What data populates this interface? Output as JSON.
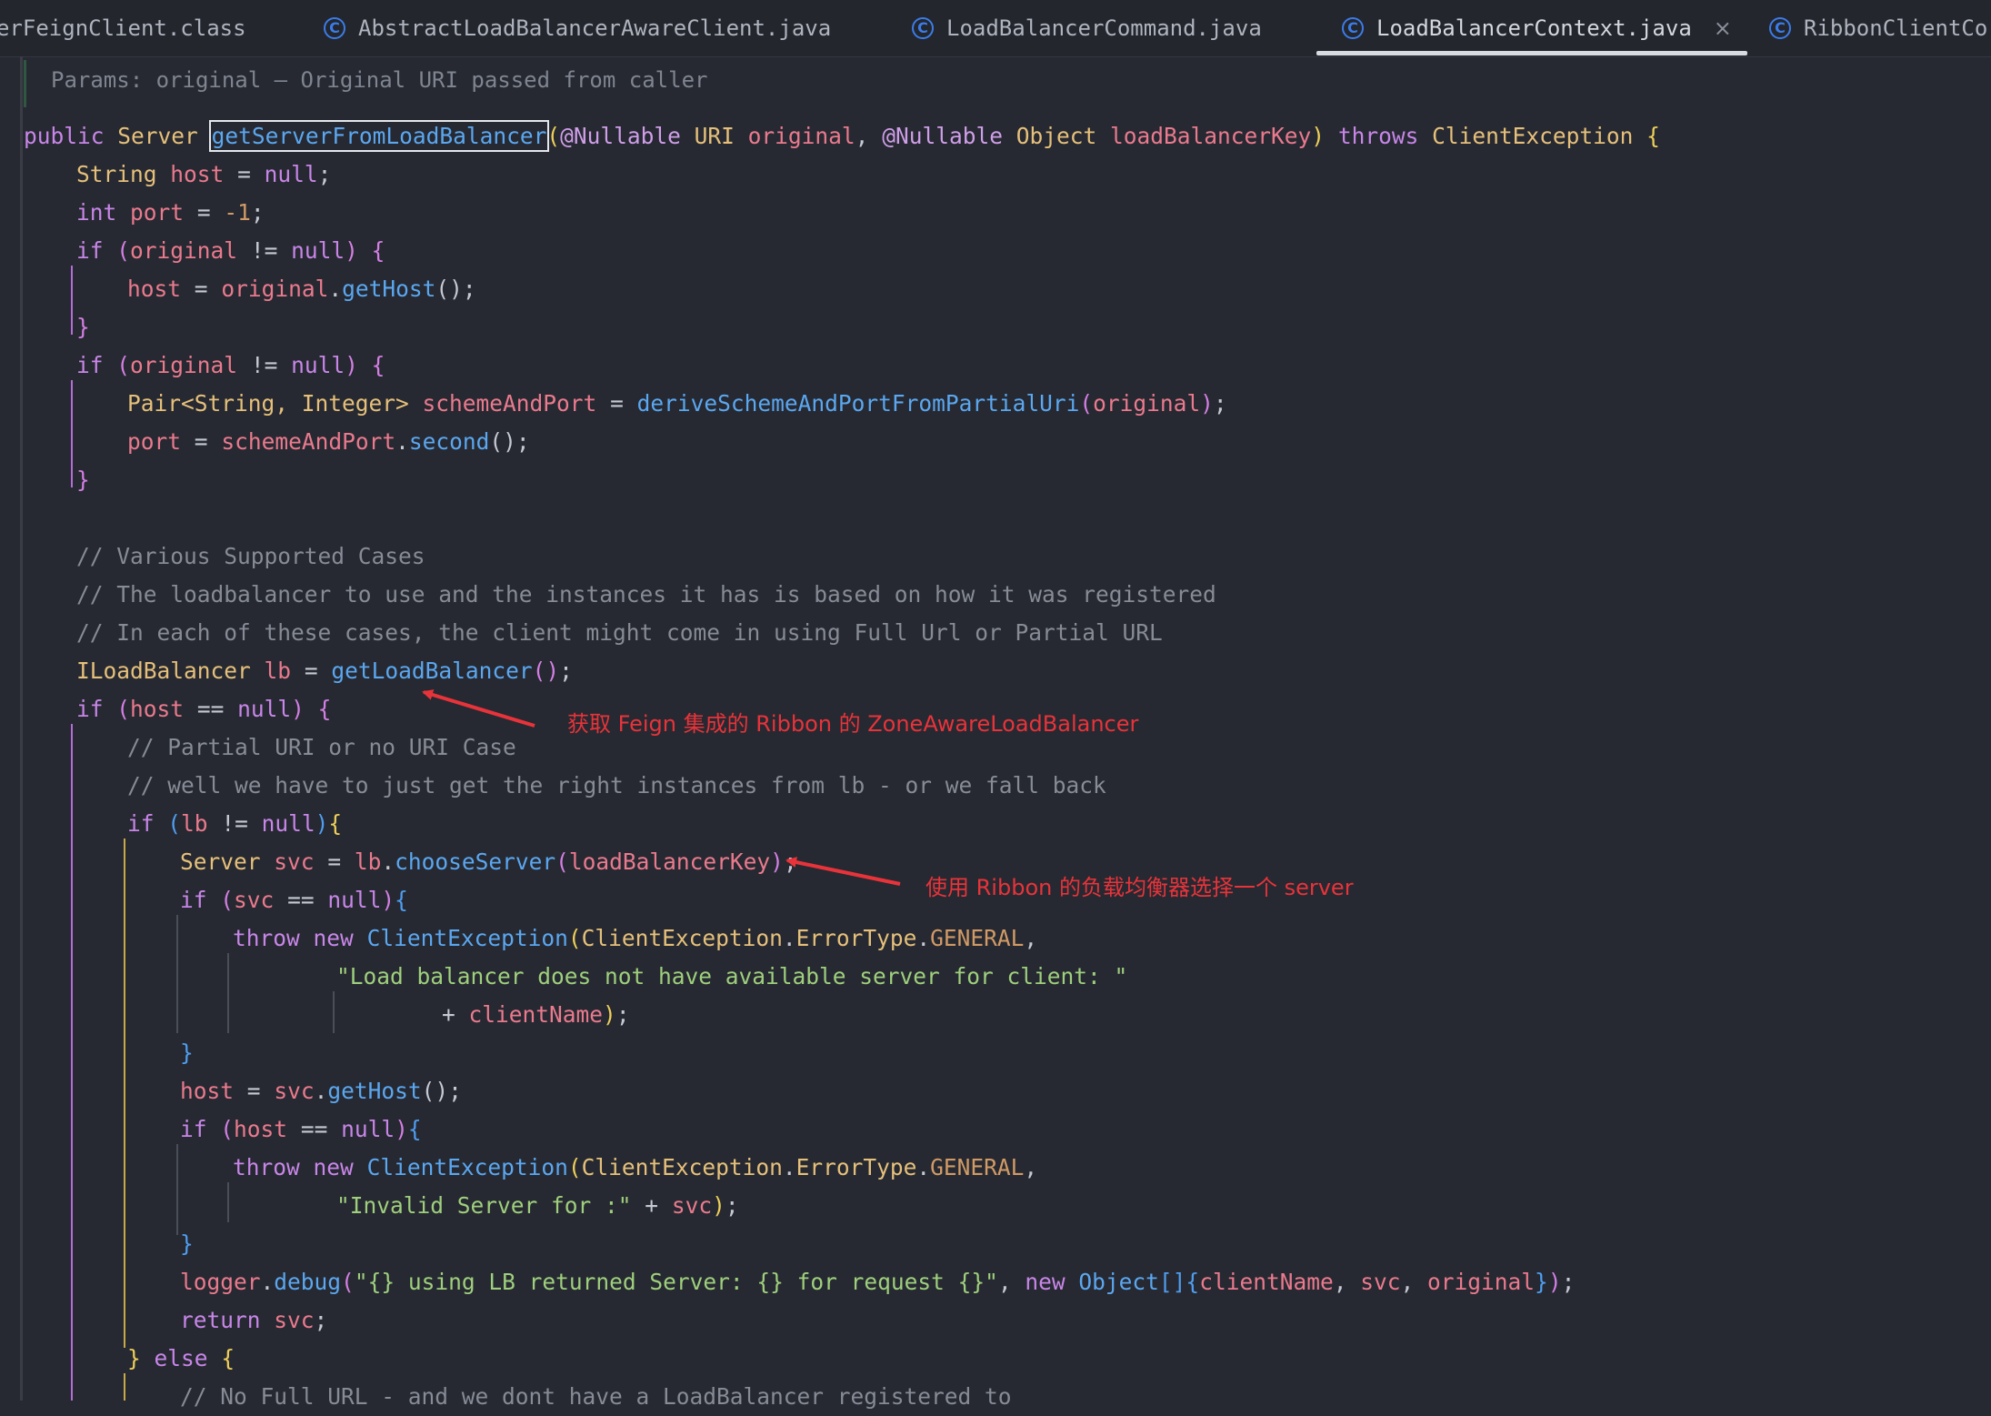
{
  "tabs": [
    {
      "label": "erFeignClient.class",
      "icon": "none",
      "active": false
    },
    {
      "label": "AbstractLoadBalancerAwareClient.java",
      "icon": "class-icon",
      "active": false
    },
    {
      "label": "LoadBalancerCommand.java",
      "icon": "class-icon",
      "active": false
    },
    {
      "label": "LoadBalancerContext.java",
      "icon": "class-icon",
      "active": true
    },
    {
      "label": "RibbonClientCo",
      "icon": "class-icon",
      "active": false
    }
  ],
  "doc_comment": "Params: original – Original URI passed from caller",
  "code": {
    "sig": {
      "public": "public",
      "ret": "Server",
      "method": "getServerFromLoadBalancer",
      "p1": "(",
      "ann1": "@Nullable",
      "t1": "URI",
      "v1": "original",
      "comma1": ",",
      "ann2": "@Nullable",
      "t2": "Object",
      "v2": "loadBalancerKey",
      "p2": ")",
      "throws": "throws",
      "ex": "ClientException",
      "open": "{"
    },
    "l1": {
      "t": "String",
      "v": "host",
      "eq": "=",
      "val": "null",
      "semi": ";"
    },
    "l2": {
      "t": "int",
      "v": "port",
      "eq": "=",
      "val": "-1",
      "semi": ";"
    },
    "l3": {
      "kw": "if",
      "p1": "(",
      "v": "original",
      "op": "!=",
      "val": "null",
      "p2": ")",
      "open": "{"
    },
    "l4": {
      "v": "host",
      "eq": "=",
      "obj": "original",
      "dot": ".",
      "fn": "getHost",
      "call": "()",
      "semi": ";"
    },
    "l5": {
      "close": "}"
    },
    "l6": {
      "kw": "if",
      "p1": "(",
      "v": "original",
      "op": "!=",
      "val": "null",
      "p2": ")",
      "open": "{"
    },
    "l7": {
      "t": "Pair",
      "gen": "<String, Integer>",
      "v": "schemeAndPort",
      "eq": "=",
      "fn": "deriveSchemeAndPortFromPartialUri",
      "p1": "(",
      "arg": "original",
      "p2": ")",
      "semi": ";"
    },
    "l8": {
      "v": "port",
      "eq": "=",
      "obj": "schemeAndPort",
      "dot": ".",
      "fn": "second",
      "call": "()",
      "semi": ";"
    },
    "l9": {
      "close": "}"
    },
    "c1": "// Various Supported Cases",
    "c2": "// The loadbalancer to use and the instances it has is based on how it was registered",
    "c3": "// In each of these cases, the client might come in using Full Url or Partial URL",
    "l10": {
      "t": "ILoadBalancer",
      "v": "lb",
      "eq": "=",
      "fn": "getLoadBalancer",
      "call": "()",
      "semi": ";"
    },
    "l11": {
      "kw": "if",
      "p1": "(",
      "v": "host",
      "op": "==",
      "val": "null",
      "p2": ")",
      "open": "{"
    },
    "c4": "// Partial URI or no URI Case",
    "c5": "// well we have to just get the right instances from lb - or we fall back",
    "l12": {
      "kw": "if",
      "p1": "(",
      "v": "lb",
      "op": "!=",
      "val": "null",
      "p2": ")",
      "open": "{"
    },
    "l13": {
      "t": "Server",
      "v": "svc",
      "eq": "=",
      "obj": "lb",
      "dot": ".",
      "fn": "chooseServer",
      "p1": "(",
      "arg": "loadBalancerKey",
      "p2": ")",
      "semi": ";"
    },
    "l14": {
      "kw": "if",
      "p1": "(",
      "v": "svc",
      "op": "==",
      "val": "null",
      "p2": ")",
      "open": "{"
    },
    "l15": {
      "kw1": "throw",
      "kw2": "new",
      "cls": "ClientException",
      "p1": "(",
      "ty": "ClientException",
      "dot1": ".",
      "ty2": "ErrorType",
      "dot2": ".",
      "const": "GENERAL",
      "comma": ","
    },
    "l16": {
      "str": "\"Load balancer does not have available server for client: \""
    },
    "l17": {
      "op": "+",
      "v": "clientName",
      "p2": ")",
      "semi": ";"
    },
    "l18": {
      "close": "}"
    },
    "l19": {
      "v": "host",
      "eq": "=",
      "obj": "svc",
      "dot": ".",
      "fn": "getHost",
      "call": "()",
      "semi": ";"
    },
    "l20": {
      "kw": "if",
      "p1": "(",
      "v": "host",
      "op": "==",
      "val": "null",
      "p2": ")",
      "open": "{"
    },
    "l21": {
      "kw1": "throw",
      "kw2": "new",
      "cls": "ClientException",
      "p1": "(",
      "ty": "ClientException",
      "dot1": ".",
      "ty2": "ErrorType",
      "dot2": ".",
      "const": "GENERAL",
      "comma": ","
    },
    "l22": {
      "str": "\"Invalid Server for :\"",
      "op": "+",
      "v": "svc",
      "p2": ")",
      "semi": ";"
    },
    "l23": {
      "close": "}"
    },
    "l24": {
      "obj": "logger",
      "dot": ".",
      "fn": "debug",
      "p1": "(",
      "str": "\"{} using LB returned Server: {} for request {}\"",
      "comma": ",",
      "kw": "new",
      "cls": "Object",
      "arr": "[]",
      "ob": "{",
      "a1": "clientName",
      "c1": ",",
      "a2": "svc",
      "c2": ",",
      "a3": "original",
      "cb": "}",
      "p2": ")",
      "semi": ";"
    },
    "l25": {
      "kw": "return",
      "v": "svc",
      "semi": ";"
    },
    "l26": {
      "close": "}",
      "kw": "else",
      "open": "{"
    },
    "c6": "// No Full URL - and we dont have a LoadBalancer registered to"
  },
  "annotations": [
    "获取 Feign 集成的 Ribbon 的 ZoneAwareLoadBalancer",
    "使用 Ribbon 的负载均衡器选择一个 server"
  ],
  "colors": {
    "background": "#262931",
    "keyword": "#c886e8",
    "type": "#e6c07b",
    "variable": "#ea7a8e",
    "function": "#5ba7f0",
    "string": "#9fcf7d",
    "comment": "#868b95",
    "annotation_text": "#e8333a",
    "active_tab_underline": "#d8dbe2",
    "class_icon": "#3b7ce8"
  }
}
